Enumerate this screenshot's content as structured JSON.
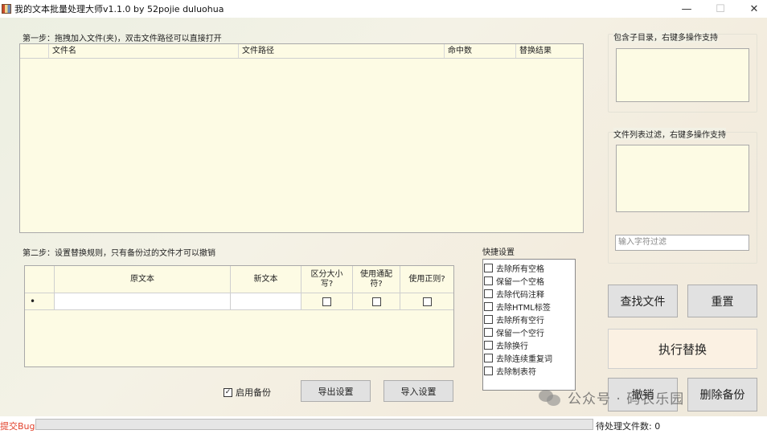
{
  "window": {
    "title": "我的文本批量处理大师v1.1.0 by 52pojie duluohua",
    "minimize": "—",
    "maximize": "☐",
    "close": "✕"
  },
  "step1": {
    "label": "第一步：拖拽加入文件(夹)，双击文件路径可以直接打开",
    "columns": [
      "",
      "文件名",
      "文件路径",
      "命中数",
      "替换结果"
    ]
  },
  "step2": {
    "label": "第二步：设置替换规则，只有备份过的文件才可以撤销",
    "columns": [
      "",
      "原文本",
      "新文本",
      "区分大小写?",
      "使用通配符?",
      "使用正则?"
    ],
    "new_row_marker": "•"
  },
  "quick": {
    "label": "快捷设置",
    "items": [
      "去除所有空格",
      "保留一个空格",
      "去除代码注释",
      "去除HTML标签",
      "去除所有空行",
      "保留一个空行",
      "去除换行",
      "去除连续重复词",
      "去除制表符"
    ]
  },
  "right": {
    "subdir_label": "包含子目录，右键多操作支持",
    "filter_label": "文件列表过滤，右键多操作支持",
    "filter_placeholder": "输入字符过滤"
  },
  "buttons": {
    "find": "查找文件",
    "reset": "重置",
    "execute": "执行替换",
    "undo": "撤销",
    "delete_backup": "删除备份",
    "export": "导出设置",
    "import": "导入设置"
  },
  "backup": {
    "label": "启用备份",
    "checked": true
  },
  "status": {
    "bug_link": "提交Bug",
    "pending": "待处理文件数: 0"
  },
  "watermark": {
    "text": "公众号 · 码农乐园"
  }
}
